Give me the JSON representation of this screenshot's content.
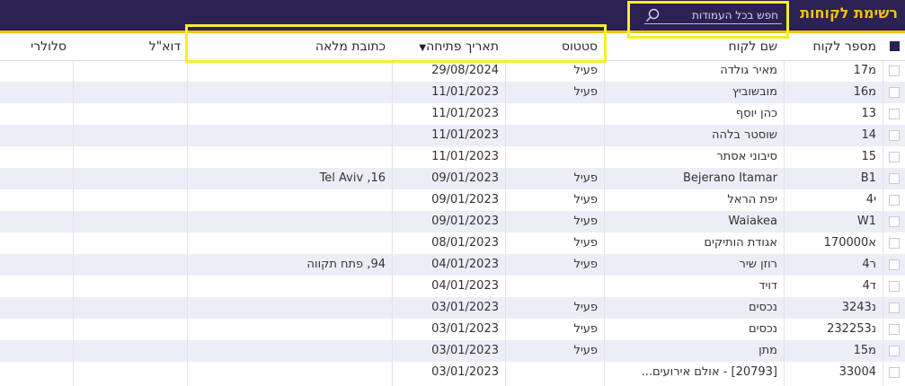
{
  "header": {
    "title": "רשימת לקוחות",
    "search_placeholder": "חפש בכל העמודות"
  },
  "columns": {
    "customer_number": "מספר לקוח",
    "customer_name": "שם לקוח",
    "status": "סטטוס",
    "open_date": "תאריך פתיחה",
    "full_address": "כתובת מלאה",
    "email": "דוא\"ל",
    "cellular": "סלולרי"
  },
  "sort": {
    "column": "open_date",
    "direction": "descending"
  },
  "colors": {
    "header_bg": "#2b2152",
    "accent": "#f3c300",
    "alt_row": "#eceef7",
    "highlight": "#f5ef2a"
  },
  "rows": [
    {
      "num": "מ17",
      "name": "מאיר גולדה",
      "status": "פעיל",
      "date": "29/08/2024",
      "address": ""
    },
    {
      "num": "מ16",
      "name": "מובשוביץ",
      "status": "פעיל",
      "date": "11/01/2023",
      "address": ""
    },
    {
      "num": "13",
      "name": "כהן יוסף",
      "status": "",
      "date": "11/01/2023",
      "address": ""
    },
    {
      "num": "14",
      "name": "שוסטר בלהה",
      "status": "",
      "date": "11/01/2023",
      "address": ""
    },
    {
      "num": "15",
      "name": "סיבוני אסתר",
      "status": "",
      "date": "11/01/2023",
      "address": ""
    },
    {
      "num": "B1",
      "name": "Bejerano Itamar",
      "status": "פעיל",
      "date": "09/01/2023",
      "address": "16, Tel Aviv"
    },
    {
      "num": "י4",
      "name": "יפת הראל",
      "status": "פעיל",
      "date": "09/01/2023",
      "address": ""
    },
    {
      "num": "W1",
      "name": "Waiakea",
      "status": "פעיל",
      "date": "09/01/2023",
      "address": ""
    },
    {
      "num": "א170000",
      "name": "אגודת הותיקים",
      "status": "פעיל",
      "date": "08/01/2023",
      "address": ""
    },
    {
      "num": "ר4",
      "name": "רוזן שיר",
      "status": "פעיל",
      "date": "04/01/2023",
      "address": "94, פתח תקווה"
    },
    {
      "num": "ד4",
      "name": "דויד",
      "status": "",
      "date": "04/01/2023",
      "address": ""
    },
    {
      "num": "נ3243",
      "name": "נכסים",
      "status": "פעיל",
      "date": "03/01/2023",
      "address": ""
    },
    {
      "num": "נ232253",
      "name": "נכסים",
      "status": "פעיל",
      "date": "03/01/2023",
      "address": ""
    },
    {
      "num": "מ15",
      "name": "מתן",
      "status": "פעיל",
      "date": "03/01/2023",
      "address": ""
    },
    {
      "num": "33004",
      "name": "[20793] - אולם אירועים...",
      "status": "",
      "date": "03/01/2023",
      "address": ""
    }
  ]
}
